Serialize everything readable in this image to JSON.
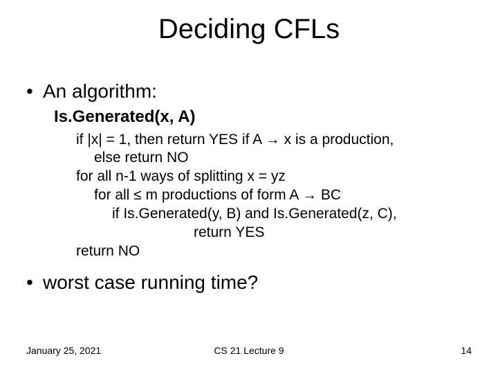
{
  "title": "Deciding CFLs",
  "bullets": {
    "algorithm": "An algorithm:",
    "funcname": "Is.Generated(x, A)",
    "algo": {
      "l1": "if |x| = 1, then return YES if A → x is a production,",
      "l2": "else return NO",
      "l3": "for all n-1 ways of splitting x = yz",
      "l4": "for all ≤ m productions of form A → BC",
      "l5": "if Is.Generated(y, B) and Is.Generated(z, C),",
      "l6": "return YES",
      "l7": "return NO"
    },
    "question": "worst case running time?"
  },
  "footer": {
    "date": "January 25, 2021",
    "course": "CS 21 Lecture 9",
    "page": "14"
  }
}
